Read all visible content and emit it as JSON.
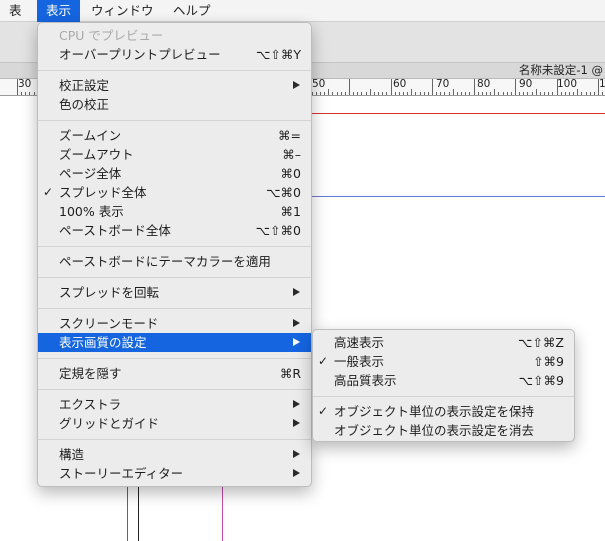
{
  "menubar": {
    "items": [
      "表",
      "表示",
      "ウィンドウ",
      "ヘルプ"
    ]
  },
  "document": {
    "title": "名称未設定-1 @"
  },
  "ruler": {
    "labels": [
      "30",
      "50",
      "60",
      "70",
      "80",
      "90",
      "100",
      "1"
    ]
  },
  "view_menu": {
    "items": [
      {
        "label": "CPU でプレビュー",
        "shortcut": ""
      },
      {
        "label": "オーバープリントプレビュー",
        "shortcut": "⌥⇧⌘Y"
      },
      {
        "label": "校正設定",
        "shortcut": ""
      },
      {
        "label": "色の校正",
        "shortcut": ""
      },
      {
        "label": "ズームイン",
        "shortcut": "⌘="
      },
      {
        "label": "ズームアウト",
        "shortcut": "⌘–"
      },
      {
        "label": "ページ全体",
        "shortcut": "⌘0"
      },
      {
        "label": "スプレッド全体",
        "shortcut": "⌥⌘0",
        "check": "✓"
      },
      {
        "label": "100% 表示",
        "shortcut": "⌘1"
      },
      {
        "label": "ペーストボード全体",
        "shortcut": "⌥⇧⌘0"
      },
      {
        "label": "ペーストボードにテーマカラーを適用",
        "shortcut": ""
      },
      {
        "label": "スプレッドを回転",
        "shortcut": ""
      },
      {
        "label": "スクリーンモード",
        "shortcut": ""
      },
      {
        "label": "表示画質の設定",
        "shortcut": ""
      },
      {
        "label": "定規を隠す",
        "shortcut": "⌘R"
      },
      {
        "label": "エクストラ",
        "shortcut": ""
      },
      {
        "label": "グリッドとガイド",
        "shortcut": ""
      },
      {
        "label": "構造",
        "shortcut": ""
      },
      {
        "label": "ストーリーエディター",
        "shortcut": ""
      }
    ]
  },
  "display_submenu": {
    "items": [
      {
        "label": "高速表示",
        "shortcut": "⌥⇧⌘Z"
      },
      {
        "label": "一般表示",
        "shortcut": "⇧⌘9",
        "check": "✓"
      },
      {
        "label": "高品質表示",
        "shortcut": "⌥⇧⌘9"
      },
      {
        "label": "オブジェクト単位の表示設定を保持",
        "shortcut": "",
        "check": "✓"
      },
      {
        "label": "オブジェクト単位の表示設定を消去",
        "shortcut": ""
      }
    ]
  },
  "colors": {
    "highlight": "#1565e0",
    "guide_red": "#d8342c",
    "guide_magenta": "#c24fb2",
    "guide_blue": "#6b78d4"
  }
}
